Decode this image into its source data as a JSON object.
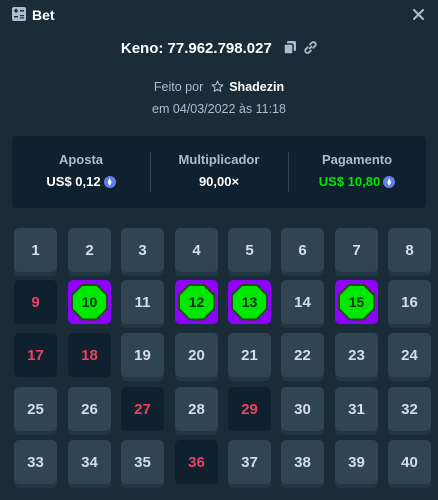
{
  "header": {
    "title": "Bet",
    "icon": "bet-slip-icon",
    "close_icon": "close-icon"
  },
  "bet_info": {
    "game_line": "Keno: 77.962.798.027",
    "copy_icon": "copy-icon",
    "link_icon": "link-icon",
    "made_by_prefix": "Feito por",
    "star_icon": "star-icon",
    "username": "Shadezin",
    "date": "em 04/03/2022 às 11:18"
  },
  "stats": {
    "bet_label": "Aposta",
    "bet_value": "US$ 0,12",
    "multiplier_label": "Multiplicador",
    "multiplier_value": "90,00×",
    "payout_label": "Pagamento",
    "payout_value": "US$ 10,80",
    "currency_icon": "ethereum-icon",
    "payout_color": "#00e701"
  },
  "board": {
    "tiles": [
      {
        "n": "1",
        "state": "none"
      },
      {
        "n": "2",
        "state": "none"
      },
      {
        "n": "3",
        "state": "none"
      },
      {
        "n": "4",
        "state": "none"
      },
      {
        "n": "5",
        "state": "none"
      },
      {
        "n": "6",
        "state": "none"
      },
      {
        "n": "7",
        "state": "none"
      },
      {
        "n": "8",
        "state": "none"
      },
      {
        "n": "9",
        "state": "miss"
      },
      {
        "n": "10",
        "state": "hit"
      },
      {
        "n": "11",
        "state": "none"
      },
      {
        "n": "12",
        "state": "hit"
      },
      {
        "n": "13",
        "state": "hit"
      },
      {
        "n": "14",
        "state": "none"
      },
      {
        "n": "15",
        "state": "hit"
      },
      {
        "n": "16",
        "state": "none"
      },
      {
        "n": "17",
        "state": "miss"
      },
      {
        "n": "18",
        "state": "miss"
      },
      {
        "n": "19",
        "state": "none"
      },
      {
        "n": "20",
        "state": "none"
      },
      {
        "n": "21",
        "state": "none"
      },
      {
        "n": "22",
        "state": "none"
      },
      {
        "n": "23",
        "state": "none"
      },
      {
        "n": "24",
        "state": "none"
      },
      {
        "n": "25",
        "state": "none"
      },
      {
        "n": "26",
        "state": "none"
      },
      {
        "n": "27",
        "state": "miss"
      },
      {
        "n": "28",
        "state": "none"
      },
      {
        "n": "29",
        "state": "miss"
      },
      {
        "n": "30",
        "state": "none"
      },
      {
        "n": "31",
        "state": "none"
      },
      {
        "n": "32",
        "state": "none"
      },
      {
        "n": "33",
        "state": "none"
      },
      {
        "n": "34",
        "state": "none"
      },
      {
        "n": "35",
        "state": "none"
      },
      {
        "n": "36",
        "state": "miss"
      },
      {
        "n": "37",
        "state": "none"
      },
      {
        "n": "38",
        "state": "none"
      },
      {
        "n": "39",
        "state": "none"
      },
      {
        "n": "40",
        "state": "none"
      }
    ],
    "hit_color": "#9000ff",
    "gem_color": "#00e701",
    "miss_text_color": "#ed4163"
  }
}
